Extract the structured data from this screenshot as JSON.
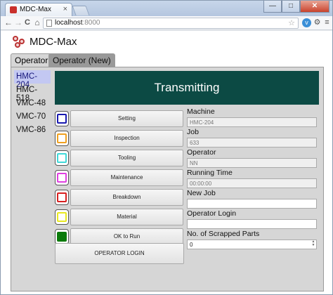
{
  "browser": {
    "tab_title": "MDC-Max",
    "tab_close": "×",
    "url_host": "localhost",
    "url_port": ":8000",
    "window_controls": [
      "—",
      "□",
      "✕"
    ],
    "nav": {
      "back": "←",
      "forward": "→",
      "reload": "C",
      "home": "⌂"
    },
    "toolbar_icons": [
      "star-icon",
      "extension-icon",
      "wrench-icon",
      "menu-icon"
    ]
  },
  "app": {
    "title": "MDC-Max"
  },
  "operator_tabs": [
    {
      "label": "Operator",
      "active": true
    },
    {
      "label": "Operator (New)",
      "active": false
    }
  ],
  "machines": [
    {
      "label": "HMC-204",
      "selected": true
    },
    {
      "label": "HMC-518",
      "selected": false
    },
    {
      "label": "VMC-48",
      "selected": false
    },
    {
      "label": "VMC-70",
      "selected": false
    },
    {
      "label": "VMC-86",
      "selected": false
    }
  ],
  "status": {
    "text": "Transmitting",
    "color": "#0c4a44"
  },
  "actions": [
    {
      "label": "Setting",
      "color": "#1a1ab0",
      "filled": false
    },
    {
      "label": "Inspection",
      "color": "#f0a020",
      "filled": false
    },
    {
      "label": "Tooling",
      "color": "#40d8d8",
      "filled": false
    },
    {
      "label": "Maintenance",
      "color": "#e040e0",
      "filled": false
    },
    {
      "label": "Breakdown",
      "color": "#d82020",
      "filled": false
    },
    {
      "label": "Material",
      "color": "#e8e820",
      "filled": false
    },
    {
      "label": "OK to Run",
      "color": "#0a7a0a",
      "filled": true
    }
  ],
  "operator_login_button": "OPERATOR LOGIN",
  "fields": {
    "machine": {
      "label": "Machine",
      "value": "HMC-204"
    },
    "job": {
      "label": "Job",
      "value": "633"
    },
    "operator": {
      "label": "Operator",
      "value": "NN"
    },
    "running_time": {
      "label": "Running Time",
      "value": "00:00:00"
    },
    "new_job": {
      "label": "New Job",
      "value": ""
    },
    "operator_login": {
      "label": "Operator Login",
      "value": ""
    },
    "scrapped_parts": {
      "label": "No. of Scrapped Parts",
      "value": "0"
    }
  }
}
